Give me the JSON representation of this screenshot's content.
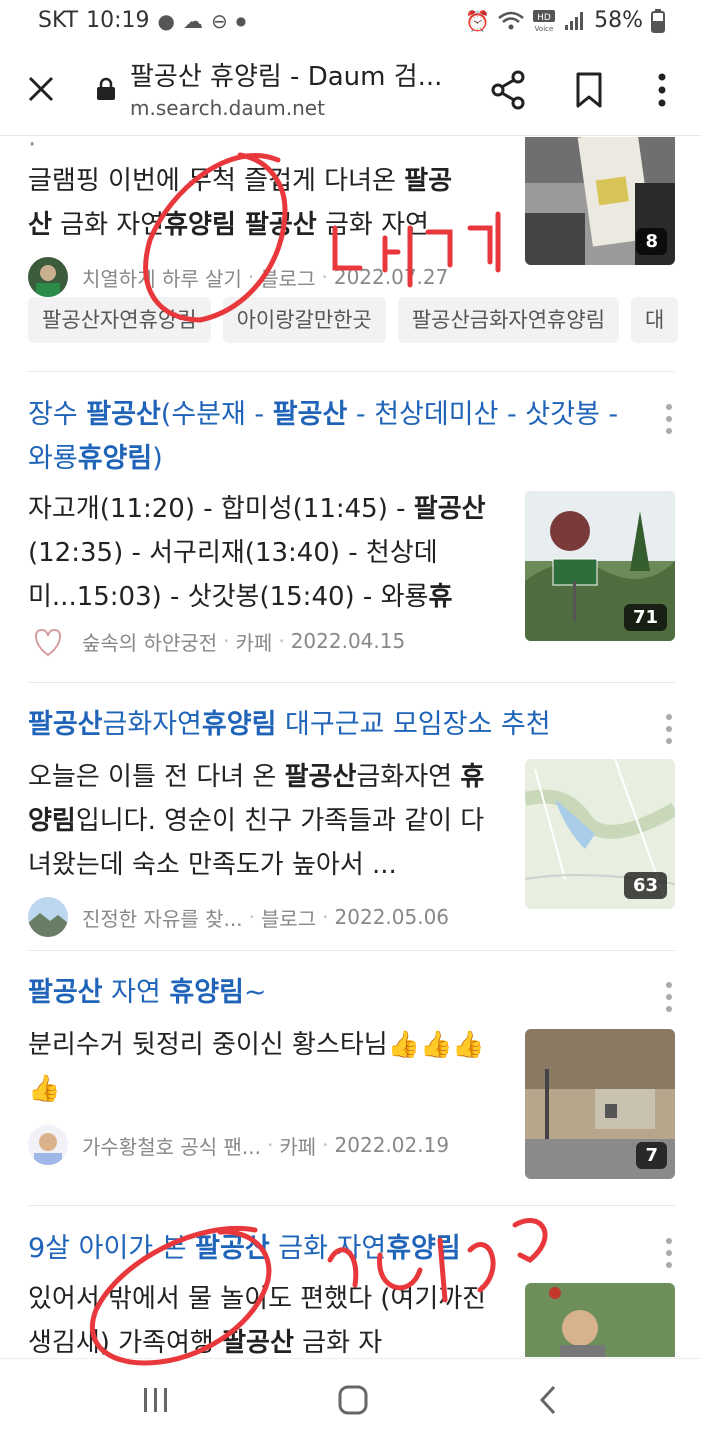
{
  "status_bar": {
    "carrier": "SKT",
    "time": "10:19",
    "battery": "58%",
    "left_icons": [
      "chat-icon",
      "cloud-icon",
      "minus-circle-icon",
      "dot-icon"
    ],
    "right_icons": [
      "alarm-icon",
      "wifi-icon",
      "hd-voice-icon",
      "signal-icon",
      "battery-icon"
    ]
  },
  "browser": {
    "title": "팔공산 휴양림 - Daum 검...",
    "url": "m.search.daum.net"
  },
  "colors": {
    "link": "#1f64b8",
    "annotation": "#e8383b"
  },
  "first_item": {
    "desc_lines": [
      "글램핑 이번에 무척 즐겁게 다녀온 팔공",
      "산 금화 자연휴양림 팔공산 금화 자연..."
    ],
    "author": "치열하게 하루 살기",
    "source": "블로그",
    "date": "2022.07.27",
    "photo_count": "8",
    "tags": [
      "팔공산자연휴양림",
      "아이랑갈만한곳",
      "팔공산금화자연휴양림",
      "대"
    ]
  },
  "results": [
    {
      "title_parts": [
        [
          "장수 ",
          false
        ],
        [
          "팔공산",
          true
        ],
        [
          "(수분재 - ",
          false
        ],
        [
          "팔공산",
          true
        ],
        [
          " - 천상데미산 - 삿갓봉 - 와룡",
          false
        ],
        [
          "휴양림",
          true
        ],
        [
          ")",
          false
        ]
      ],
      "desc_parts": [
        [
          "자고개(11:20) - 합미성(11:45) - ",
          false
        ],
        [
          "팔공산",
          true
        ],
        [
          "(12:35) - 서구리재(13:40) - 천상데미...15:03) - 삿갓봉(15:40) - 와룡",
          false
        ],
        [
          "휴",
          true
        ]
      ],
      "author": "숲속의 하얀궁전",
      "source": "카페",
      "date": "2022.04.15",
      "photo_count": "71"
    },
    {
      "title_parts": [
        [
          "팔공산",
          true
        ],
        [
          "금화자연",
          false
        ],
        [
          "휴양림",
          true
        ],
        [
          " 대구근교 모임장소 추천",
          false
        ]
      ],
      "desc_parts": [
        [
          "오늘은 이틀 전 다녀 온 ",
          false
        ],
        [
          "팔공산",
          true
        ],
        [
          "금화자연 ",
          false
        ],
        [
          "휴양림",
          true
        ],
        [
          "입니다. 영순이 친구 가족들과 같이 다녀왔는데 숙소 만족도가 높아서 ...",
          false
        ]
      ],
      "author": "진정한 자유를 찾...",
      "source": "블로그",
      "date": "2022.05.06",
      "photo_count": "63"
    },
    {
      "title_parts": [
        [
          "팔공산",
          true
        ],
        [
          " 자연 ",
          false
        ],
        [
          "휴양림",
          true
        ],
        [
          "~",
          false
        ]
      ],
      "desc_parts": [
        [
          "분리수거 뒷정리 중이신 황스타님👍👍👍👍",
          false
        ]
      ],
      "author": "가수황철호 공식 팬...",
      "source": "카페",
      "date": "2022.02.19",
      "photo_count": "7"
    },
    {
      "title_parts": [
        [
          "9살 아이가 본 ",
          false
        ],
        [
          "팔공산",
          true
        ],
        [
          " 금화 자연",
          false
        ],
        [
          "휴양림",
          true
        ]
      ],
      "desc_parts": [
        [
          "있어서 밖에서 물 놀이도 편했다 (여기까진 생김새) 가족여행 ",
          false
        ],
        [
          "팔공산",
          true
        ],
        [
          " 금화 자",
          false
        ]
      ],
      "author": "",
      "source": "",
      "date": "",
      "photo_count": ""
    }
  ]
}
